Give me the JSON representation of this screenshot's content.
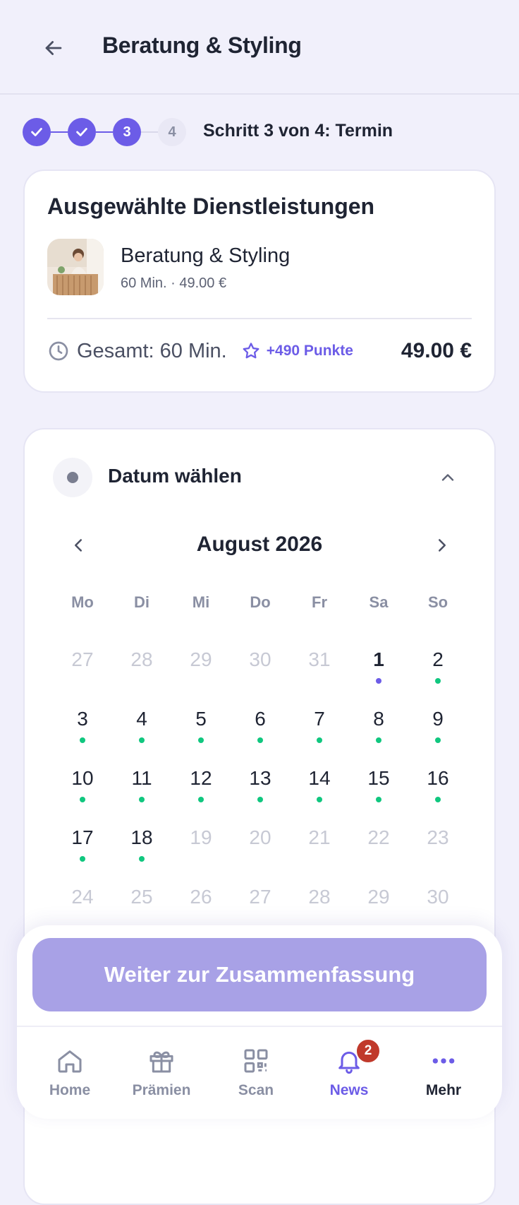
{
  "header": {
    "title": "Beratung & Styling"
  },
  "stepper": {
    "steps": [
      "✓",
      "✓",
      "3",
      "4"
    ],
    "label": "Schritt 3 von 4: Termin"
  },
  "services_card": {
    "title": "Ausgewählte Dienstleistungen",
    "service_name": "Beratung & Styling",
    "service_meta": "60 Min. · 49.00 €",
    "total": "Gesamt: 60 Min.",
    "points": "+490 Punkte",
    "price": "49.00 €"
  },
  "date_card": {
    "title": "Datum wählen",
    "month": "August 2026",
    "weekdays": [
      "Mo",
      "Di",
      "Mi",
      "Do",
      "Fr",
      "Sa",
      "So"
    ],
    "days": [
      {
        "n": "27",
        "state": "disabled"
      },
      {
        "n": "28",
        "state": "disabled"
      },
      {
        "n": "29",
        "state": "disabled"
      },
      {
        "n": "30",
        "state": "disabled"
      },
      {
        "n": "31",
        "state": "disabled"
      },
      {
        "n": "1",
        "state": "today"
      },
      {
        "n": "2",
        "state": "available"
      },
      {
        "n": "3",
        "state": "available"
      },
      {
        "n": "4",
        "state": "available"
      },
      {
        "n": "5",
        "state": "available"
      },
      {
        "n": "6",
        "state": "available"
      },
      {
        "n": "7",
        "state": "available"
      },
      {
        "n": "8",
        "state": "available"
      },
      {
        "n": "9",
        "state": "available"
      },
      {
        "n": "10",
        "state": "available"
      },
      {
        "n": "11",
        "state": "available"
      },
      {
        "n": "12",
        "state": "available"
      },
      {
        "n": "13",
        "state": "available"
      },
      {
        "n": "14",
        "state": "available"
      },
      {
        "n": "15",
        "state": "available"
      },
      {
        "n": "16",
        "state": "available"
      },
      {
        "n": "17",
        "state": "available"
      },
      {
        "n": "18",
        "state": "available"
      },
      {
        "n": "19",
        "state": "disabled"
      },
      {
        "n": "20",
        "state": "disabled"
      },
      {
        "n": "21",
        "state": "disabled"
      },
      {
        "n": "22",
        "state": "disabled"
      },
      {
        "n": "23",
        "state": "disabled"
      },
      {
        "n": "24",
        "state": "disabled"
      },
      {
        "n": "25",
        "state": "disabled"
      },
      {
        "n": "26",
        "state": "disabled"
      },
      {
        "n": "27",
        "state": "disabled"
      },
      {
        "n": "28",
        "state": "disabled"
      },
      {
        "n": "29",
        "state": "disabled"
      },
      {
        "n": "30",
        "state": "disabled"
      }
    ]
  },
  "cta": {
    "label": "Weiter zur Zusammenfassung"
  },
  "nav": {
    "items": [
      {
        "label": "Home",
        "icon": "home-icon"
      },
      {
        "label": "Prämien",
        "icon": "gift-icon"
      },
      {
        "label": "Scan",
        "icon": "qr-icon"
      },
      {
        "label": "News",
        "icon": "bell-icon",
        "badge": "2"
      },
      {
        "label": "Mehr",
        "icon": "more-icon"
      }
    ]
  },
  "colors": {
    "accent": "#6c5ce7",
    "available_dot": "#10c77f",
    "badge": "#c0392b",
    "cta_disabled": "#a8a1e6"
  }
}
